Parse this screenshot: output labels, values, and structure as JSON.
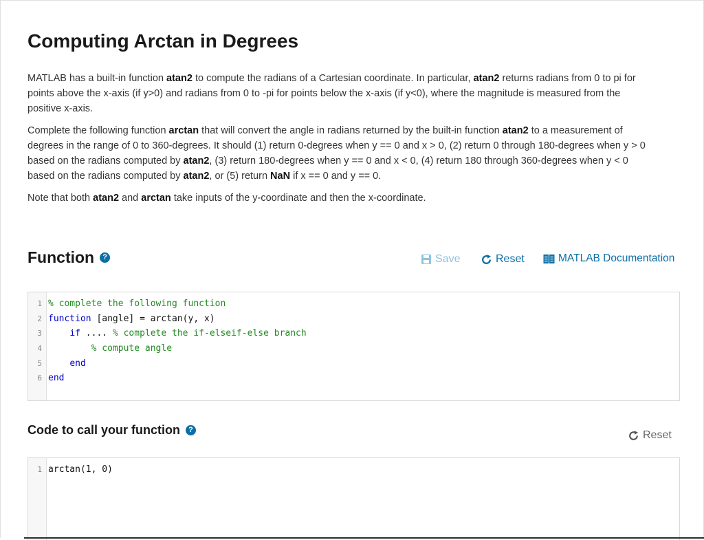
{
  "page": {
    "title": "Computing Arctan in Degrees"
  },
  "description": {
    "p1": [
      {
        "t": "MATLAB has a built-in function "
      },
      {
        "t": "atan2",
        "b": true
      },
      {
        "t": " to compute the radians of a Cartesian coordinate. In particular, "
      },
      {
        "t": "atan2",
        "b": true
      },
      {
        "t": " returns radians from 0 to pi for points above the x-axis (if y>0) and radians from 0 to -pi for points below the x-axis (if y<0), where the magnitude is measured from the positive x-axis."
      }
    ],
    "p2": [
      {
        "t": "Complete the following function "
      },
      {
        "t": "arctan",
        "b": true
      },
      {
        "t": " that will convert the angle in radians returned by the built-in function "
      },
      {
        "t": "atan2",
        "b": true
      },
      {
        "t": " to a measurement of degrees in the range of 0 to 360-degrees. It should (1) return 0-degrees when y == 0 and x > 0, (2) return 0 through 180-degrees when y > 0 based on the radians computed by "
      },
      {
        "t": "atan2",
        "b": true
      },
      {
        "t": ", (3) return 180-degrees when y == 0 and x < 0, (4) return 180 through 360-degrees when y < 0 based on the radians computed by "
      },
      {
        "t": "atan2",
        "b": true
      },
      {
        "t": ", or (5) return "
      },
      {
        "t": "NaN",
        "b": true
      },
      {
        "t": " if x == 0 and y == 0."
      }
    ],
    "p3": [
      {
        "t": "Note that both "
      },
      {
        "t": "atan2",
        "b": true
      },
      {
        "t": " and "
      },
      {
        "t": "arctan",
        "b": true
      },
      {
        "t": " take inputs of the y-coordinate and then the x-coordinate."
      }
    ]
  },
  "function_section": {
    "title": "Function",
    "help_icon": "question-circle-icon",
    "save_label": "Save",
    "reset_label": "Reset",
    "docs_label": "MATLAB Documentation",
    "code_lines": [
      [
        {
          "t": "% complete the following function",
          "c": "cm"
        }
      ],
      [
        {
          "t": "function",
          "c": "kw"
        },
        {
          "t": " [angle] = arctan(y, x)"
        }
      ],
      [
        {
          "t": "    "
        },
        {
          "t": "if",
          "c": "kw"
        },
        {
          "t": " .... "
        },
        {
          "t": "% complete the if-elseif-else branch",
          "c": "cm"
        }
      ],
      [
        {
          "t": "        "
        },
        {
          "t": "% compute angle",
          "c": "cm"
        }
      ],
      [
        {
          "t": "    "
        },
        {
          "t": "end",
          "c": "kw"
        }
      ],
      [
        {
          "t": "end",
          "c": "kw"
        }
      ]
    ]
  },
  "call_section": {
    "title": "Code to call your function",
    "help_icon": "question-circle-icon",
    "reset_label": "Reset",
    "code_lines": [
      [
        {
          "t": "arctan(1, 0)"
        }
      ]
    ]
  },
  "colors": {
    "accent": "#0c6fa5",
    "save_disabled": "#8fc3de",
    "keyword": "#0000cc",
    "comment": "#228b22"
  }
}
